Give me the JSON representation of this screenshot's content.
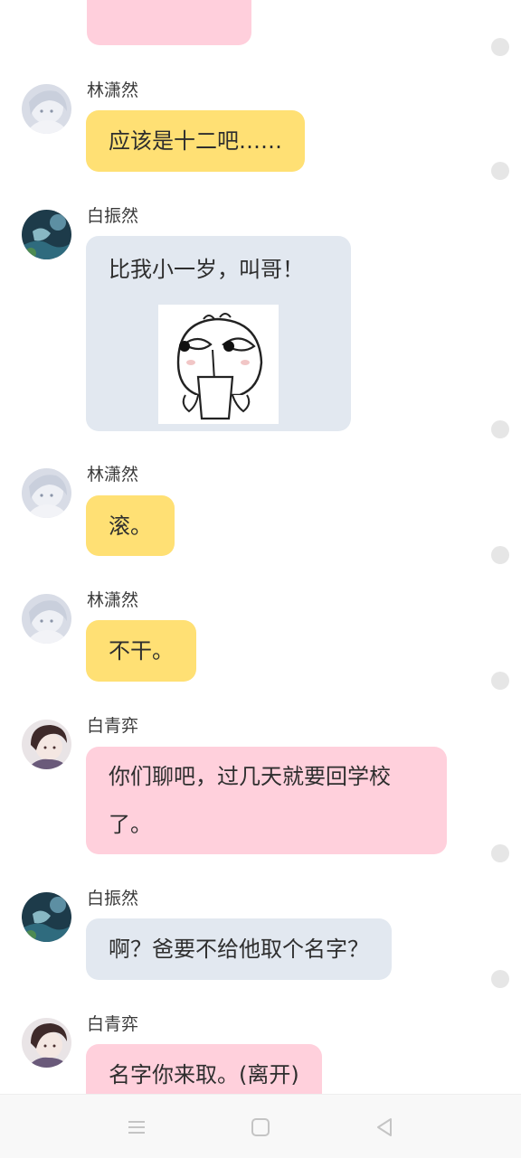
{
  "messages": [
    {
      "sender": "林潇然",
      "text": "应该是十二吧……",
      "color": "yellow"
    },
    {
      "sender": "白振然",
      "text": "比我小一岁，叫哥！",
      "color": "grey",
      "has_sticker": true,
      "sticker_icon": "meme-sticker-icon"
    },
    {
      "sender": "林潇然",
      "text": "滚。",
      "color": "yellow"
    },
    {
      "sender": "林潇然",
      "text": "不干。",
      "color": "yellow"
    },
    {
      "sender": "白青弈",
      "text": "你们聊吧，过几天就要回学校了。",
      "color": "pink"
    },
    {
      "sender": "白振然",
      "text": "啊？爸要不给他取个名字？",
      "color": "grey"
    },
    {
      "sender": "白青弈",
      "text": "名字你来取。(离开)",
      "color": "pink"
    }
  ],
  "colors": {
    "yellow": "#ffe074",
    "grey": "#e2e8f0",
    "pink": "#ffd0dc"
  },
  "navbar": {
    "icons": [
      "menu-icon",
      "home-icon",
      "back-icon"
    ]
  }
}
